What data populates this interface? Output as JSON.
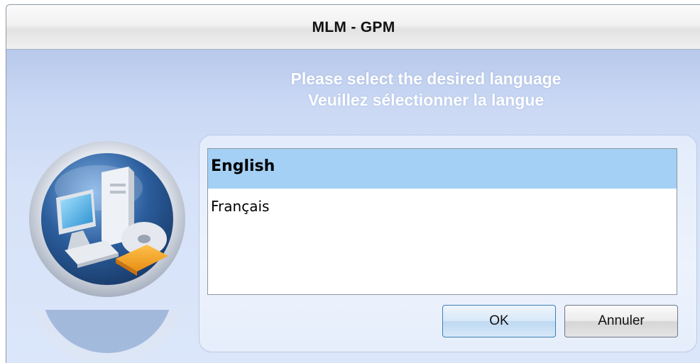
{
  "window": {
    "title": "MLM - GPM"
  },
  "prompt": {
    "english": "Please select the desired language",
    "french": "Veuillez sélectionner la langue"
  },
  "languages": [
    {
      "label": "English",
      "selected": true
    },
    {
      "label": "Français",
      "selected": false
    }
  ],
  "buttons": {
    "ok": "OK",
    "cancel": "Annuler"
  },
  "logo": {
    "icon": "computer-icon"
  },
  "colors": {
    "selection": "#a4d0f5",
    "background_top": "#9fb4dc",
    "background_bottom": "#dbe6fa",
    "prompt_text": "#ffffff"
  }
}
